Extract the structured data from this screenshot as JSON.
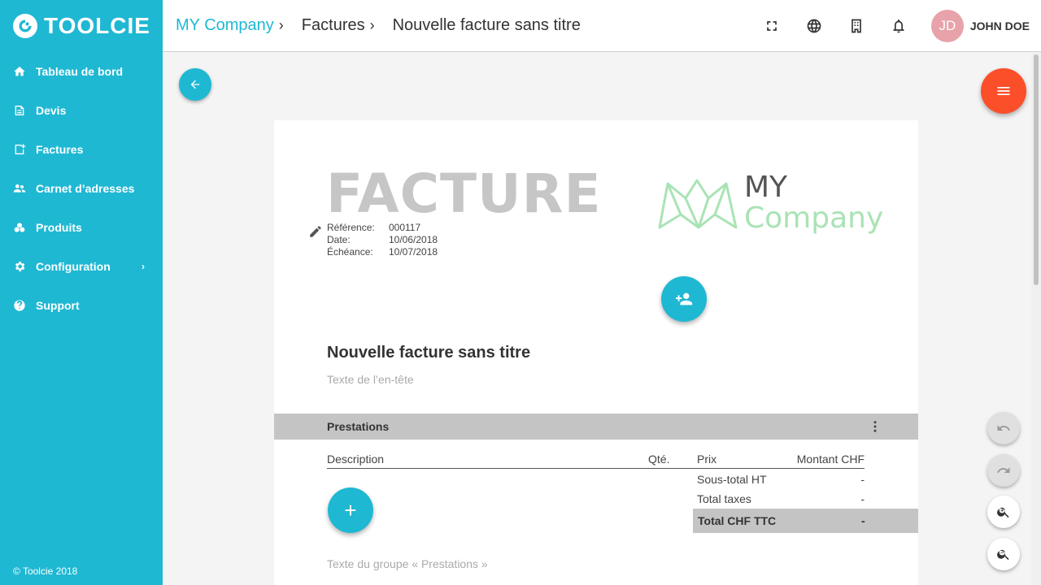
{
  "brand": {
    "name": "TOOLCIE"
  },
  "sidebar": {
    "items": [
      {
        "label": "Tableau de bord",
        "icon": "home-icon"
      },
      {
        "label": "Devis",
        "icon": "quote-icon"
      },
      {
        "label": "Factures",
        "icon": "invoice-icon"
      },
      {
        "label": "Carnet d’adresses",
        "icon": "contacts-icon"
      },
      {
        "label": "Produits",
        "icon": "products-icon"
      },
      {
        "label": "Configuration",
        "icon": "gear-icon"
      },
      {
        "label": "Support",
        "icon": "help-icon"
      }
    ],
    "footer": "© Toolcie 2018"
  },
  "topbar": {
    "breadcrumbs": [
      {
        "label": "MY Company"
      },
      {
        "label": "Factures"
      },
      {
        "label": "Nouvelle facture sans titre"
      }
    ],
    "user": {
      "initials": "JD",
      "name": "JOHN DOE"
    }
  },
  "invoice": {
    "heading": "FACTURE",
    "meta": [
      {
        "label": "Référence:",
        "value": "000117"
      },
      {
        "label": "Date:",
        "value": "10/06/2018"
      },
      {
        "label": "Échéance:",
        "value": "10/07/2018"
      }
    ],
    "logo": {
      "line1": "MY",
      "line2": "Company"
    },
    "title": "Nouvelle facture sans titre",
    "header_placeholder": "Texte de l’en-tête",
    "section": "Prestations",
    "columns": {
      "description": "Description",
      "qty": "Qté.",
      "price": "Prix",
      "amount": "Montant CHF"
    },
    "subtotal": {
      "label": "Sous-total HT",
      "value": "-"
    },
    "taxes": {
      "label": "Total taxes",
      "value": "-"
    },
    "total": {
      "label": "Total CHF TTC",
      "value": "-"
    },
    "group_placeholder": "Texte du groupe « Prestations »"
  },
  "colors": {
    "primary": "#1fb8d3",
    "accent": "#fb4f2a",
    "logo_green": "#a9e3b5",
    "avatar": "#e8a2aa"
  }
}
